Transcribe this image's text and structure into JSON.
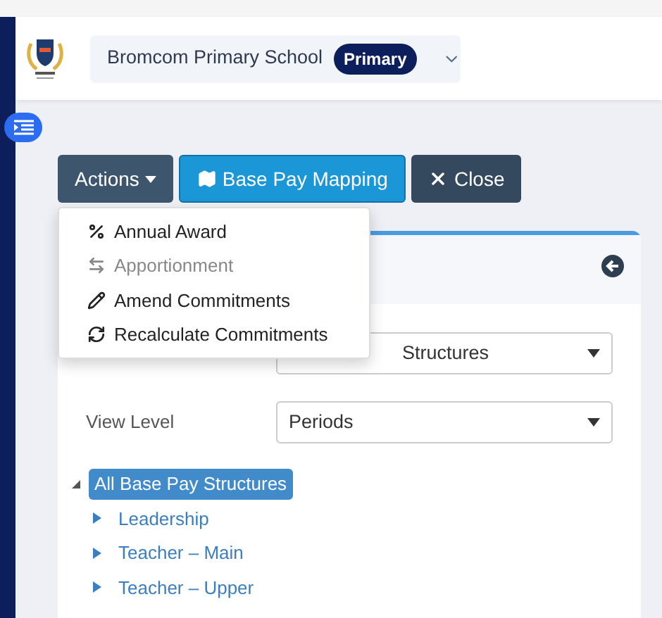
{
  "header": {
    "school": "Bromcom Primary School",
    "badge": "Primary"
  },
  "toolbar": [
    {
      "label": "Actions",
      "kind": "dropdown"
    },
    {
      "label": "Base Pay Mapping",
      "kind": "map"
    },
    {
      "label": "Close",
      "kind": "close"
    }
  ],
  "actions_menu": {
    "open": true,
    "items": [
      {
        "label": "Annual Award",
        "kind": "percent",
        "disabled": false
      },
      {
        "label": "Apportionment",
        "kind": "transfer",
        "disabled": true
      },
      {
        "label": "Amend Commitments",
        "kind": "pencil",
        "disabled": false
      },
      {
        "label": "Recalculate Commitments",
        "kind": "refresh",
        "disabled": false
      }
    ]
  },
  "form": {
    "structure_select": {
      "value": "Structures"
    },
    "view_level": {
      "label": "View Level",
      "value": "Periods"
    }
  },
  "tree": {
    "label": "All Base Pay Structures",
    "selected": true,
    "expanded": true,
    "children": [
      {
        "label": "Leadership",
        "selected": false,
        "expanded": false
      },
      {
        "label": "Teacher – Main",
        "selected": false,
        "expanded": false
      },
      {
        "label": "Teacher – Upper",
        "selected": false,
        "expanded": false
      }
    ]
  }
}
